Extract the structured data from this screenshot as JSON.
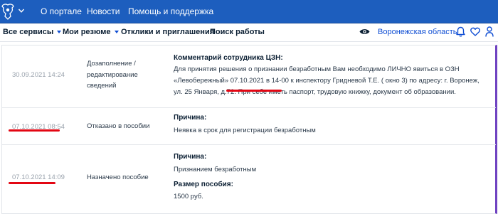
{
  "topbar": {
    "emblem_icon": "coat-of-arms-icon",
    "menu_icon": "chevron-down-icon",
    "links": [
      "О портале",
      "Новости",
      "Помощь и поддержка"
    ],
    "color": "#1d5ebe"
  },
  "nav": {
    "items": [
      {
        "label": "Все сервисы",
        "dropdown": true
      },
      {
        "label": "Мои резюме",
        "dropdown": true
      },
      {
        "label": "Отклики и приглашения",
        "dropdown": false
      },
      {
        "label": "Поиск работы",
        "dropdown": false
      }
    ],
    "eye_icon": "eye-icon",
    "region": "Воронежская область",
    "icons": [
      "bell-icon",
      "heart-icon",
      "user-icon"
    ],
    "accent": "#0d4cd3"
  },
  "history": [
    {
      "date": "30.09.2021 14:24",
      "status": "Дозаполнение / редактирование сведений",
      "label": "Комментарий сотрудника ЦЗН:",
      "text": "Для принятия решения о признании безработным Вам необходимо ЛИЧНО явиться в ОЗН «Левобережный» 07.10.2021 в 14-00 к инспектору Гридневой Т.Е. ( окно 3) по адресу: г. Воронеж, ул. 25 Января, д.72. При себе иметь паспорт, трудовую книжку, документ об образовании."
    },
    {
      "date": "07.10.2021 08:54",
      "status": "Отказано в пособии",
      "label": "Причина:",
      "text": "Неявка в срок для регистрации безработным"
    },
    {
      "date": "07.10.2021 14:09",
      "status": "Назначено пособие",
      "label": "Причина:",
      "text": "Признанием безработным",
      "label2": "Размер пособия:",
      "text2": "1500 руб."
    }
  ],
  "annotation_color": "#e30613"
}
